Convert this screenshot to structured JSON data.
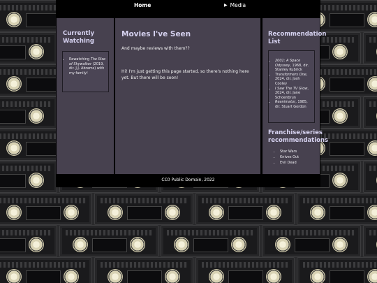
{
  "nav": {
    "home": "Home",
    "media": "Media"
  },
  "left": {
    "title": "Currently Watching",
    "items": [
      {
        "pre": "Rewatching ",
        "title": "The Rise of Skywalker",
        "post": " (2019, dir. J.J. Abrams) with my family!"
      }
    ]
  },
  "main": {
    "title": "Movies I've Seen",
    "subtitle": "And maybe reviews with them??",
    "body": "Hi! I'm just getting this page started, so there's nothing here yet. But there will be soon!"
  },
  "right": {
    "title": "Recommendation List",
    "items": [
      {
        "title": "2001: A Space Odyssey",
        "post": ", 1968, dir. Stanley Kubrick"
      },
      {
        "title": "Transformers One",
        "post": ", 2024, dir. Josh Cooley"
      },
      {
        "title": "I Saw The TV Glow",
        "post": ", 2024, dir. Jane Schoenbrun"
      },
      {
        "title": "Reanimator",
        "post": ", 1985, dir. Stuart Gordon"
      }
    ],
    "franchise_title": "Franchise/series recommendations",
    "franchise": [
      "Star Wars",
      "Knives Out",
      "Evil Dead"
    ]
  },
  "footer": "CC0 Public Domain, 2022"
}
